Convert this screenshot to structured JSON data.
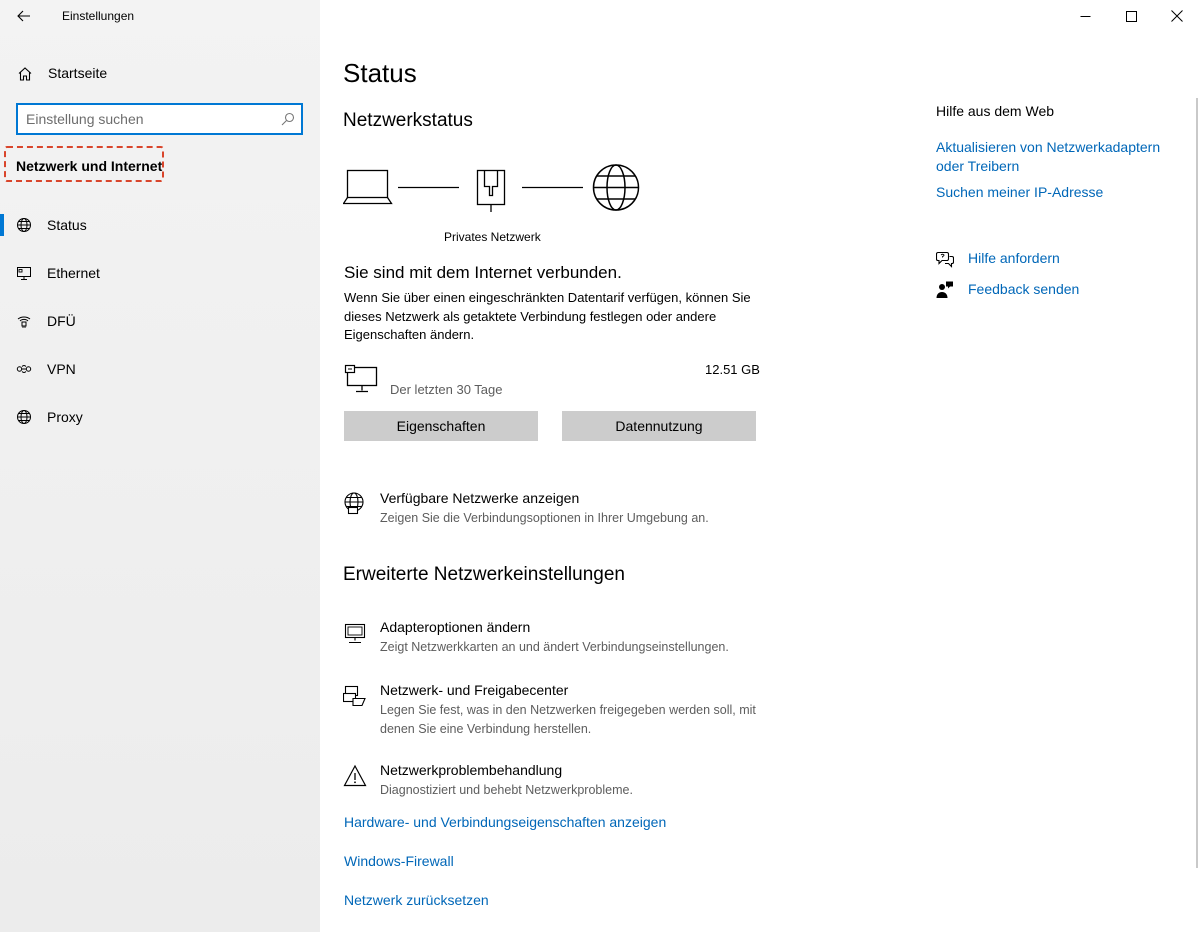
{
  "window": {
    "title": "Einstellungen"
  },
  "sidebar": {
    "home_label": "Startseite",
    "search_placeholder": "Einstellung suchen",
    "section_title": "Netzwerk und Internet",
    "items": [
      {
        "label": "Status",
        "icon": "globe-icon",
        "active": true
      },
      {
        "label": "Ethernet",
        "icon": "ethernet-icon",
        "active": false
      },
      {
        "label": "DFÜ",
        "icon": "dialup-icon",
        "active": false
      },
      {
        "label": "VPN",
        "icon": "vpn-icon",
        "active": false
      },
      {
        "label": "Proxy",
        "icon": "globe-icon",
        "active": false
      }
    ]
  },
  "main": {
    "title": "Status",
    "network_status_heading": "Netzwerkstatus",
    "network_name": "Privates Netzwerk",
    "connected_text": "Sie sind mit dem Internet verbunden.",
    "description": "Wenn Sie über einen eingeschränkten Datentarif verfügen, können Sie dieses Netzwerk als getaktete Verbindung festlegen oder andere Eigenschaften ändern.",
    "usage": {
      "amount": "12.51 GB",
      "period": "Der letzten 30 Tage"
    },
    "buttons": {
      "properties": "Eigenschaften",
      "data_usage": "Datennutzung"
    },
    "available_networks": {
      "title": "Verfügbare Netzwerke anzeigen",
      "subtitle": "Zeigen Sie die Verbindungsoptionen in Ihrer Umgebung an."
    },
    "advanced_heading": "Erweiterte Netzwerkeinstellungen",
    "advanced_items": [
      {
        "title": "Adapteroptionen ändern",
        "subtitle": "Zeigt Netzwerkkarten an und ändert Verbindungseinstellungen."
      },
      {
        "title": "Netzwerk- und Freigabecenter",
        "subtitle": "Legen Sie fest, was in den Netzwerken freigegeben werden soll, mit denen Sie eine Verbindung herstellen."
      },
      {
        "title": "Netzwerkproblembehandlung",
        "subtitle": "Diagnostiziert und behebt Netzwerkprobleme."
      }
    ],
    "links": [
      "Hardware- und Verbindungseigenschaften anzeigen",
      "Windows-Firewall",
      "Netzwerk zurücksetzen"
    ]
  },
  "help": {
    "heading": "Hilfe aus dem Web",
    "links": [
      "Aktualisieren von Netzwerkadaptern oder Treibern",
      "Suchen meiner IP-Adresse"
    ],
    "get_help": "Hilfe anfordern",
    "feedback": "Feedback senden"
  },
  "colors": {
    "accent": "#0078d4",
    "link": "#0067b8",
    "highlight_border": "#d9452b",
    "button_bg": "#cccccc"
  }
}
